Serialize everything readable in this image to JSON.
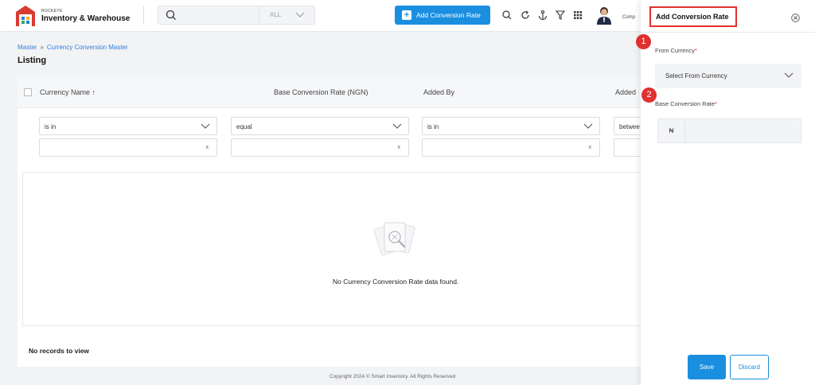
{
  "brand": {
    "small": "ROCKEYE",
    "name": "Inventory & Warehouse"
  },
  "search": {
    "scope": "ALL"
  },
  "header": {
    "add_button": "Add Conversion Rate",
    "company": "Comp"
  },
  "breadcrumb": {
    "root": "Master",
    "sep": "»",
    "current": "Currency Conversion Master"
  },
  "page": {
    "title": "Listing"
  },
  "table": {
    "columns": [
      "Currency Name ↑",
      "Base Conversion Rate (NGN)",
      "Added By",
      "Added"
    ],
    "filters": [
      "is in",
      "equal",
      "is in",
      "betwee"
    ],
    "clear": "x",
    "empty_message": "No Currency Conversion Rate data found.",
    "no_records": "No records to view"
  },
  "footer": {
    "copyright": "Copyright 2024 © Smart Inventory. All Rights Reserved"
  },
  "drawer": {
    "title": "Add Conversion Rate",
    "step1": "1",
    "step2": "2",
    "from_label": "From Currency",
    "from_placeholder": "Select From Currency",
    "rate_label": "Base Conversion Rate",
    "required_mark": "*",
    "currency_symbol": "₦",
    "save": "Save",
    "discard": "Discard"
  },
  "colors": {
    "primary": "#1a8fe0",
    "annotation": "#e0302f"
  }
}
